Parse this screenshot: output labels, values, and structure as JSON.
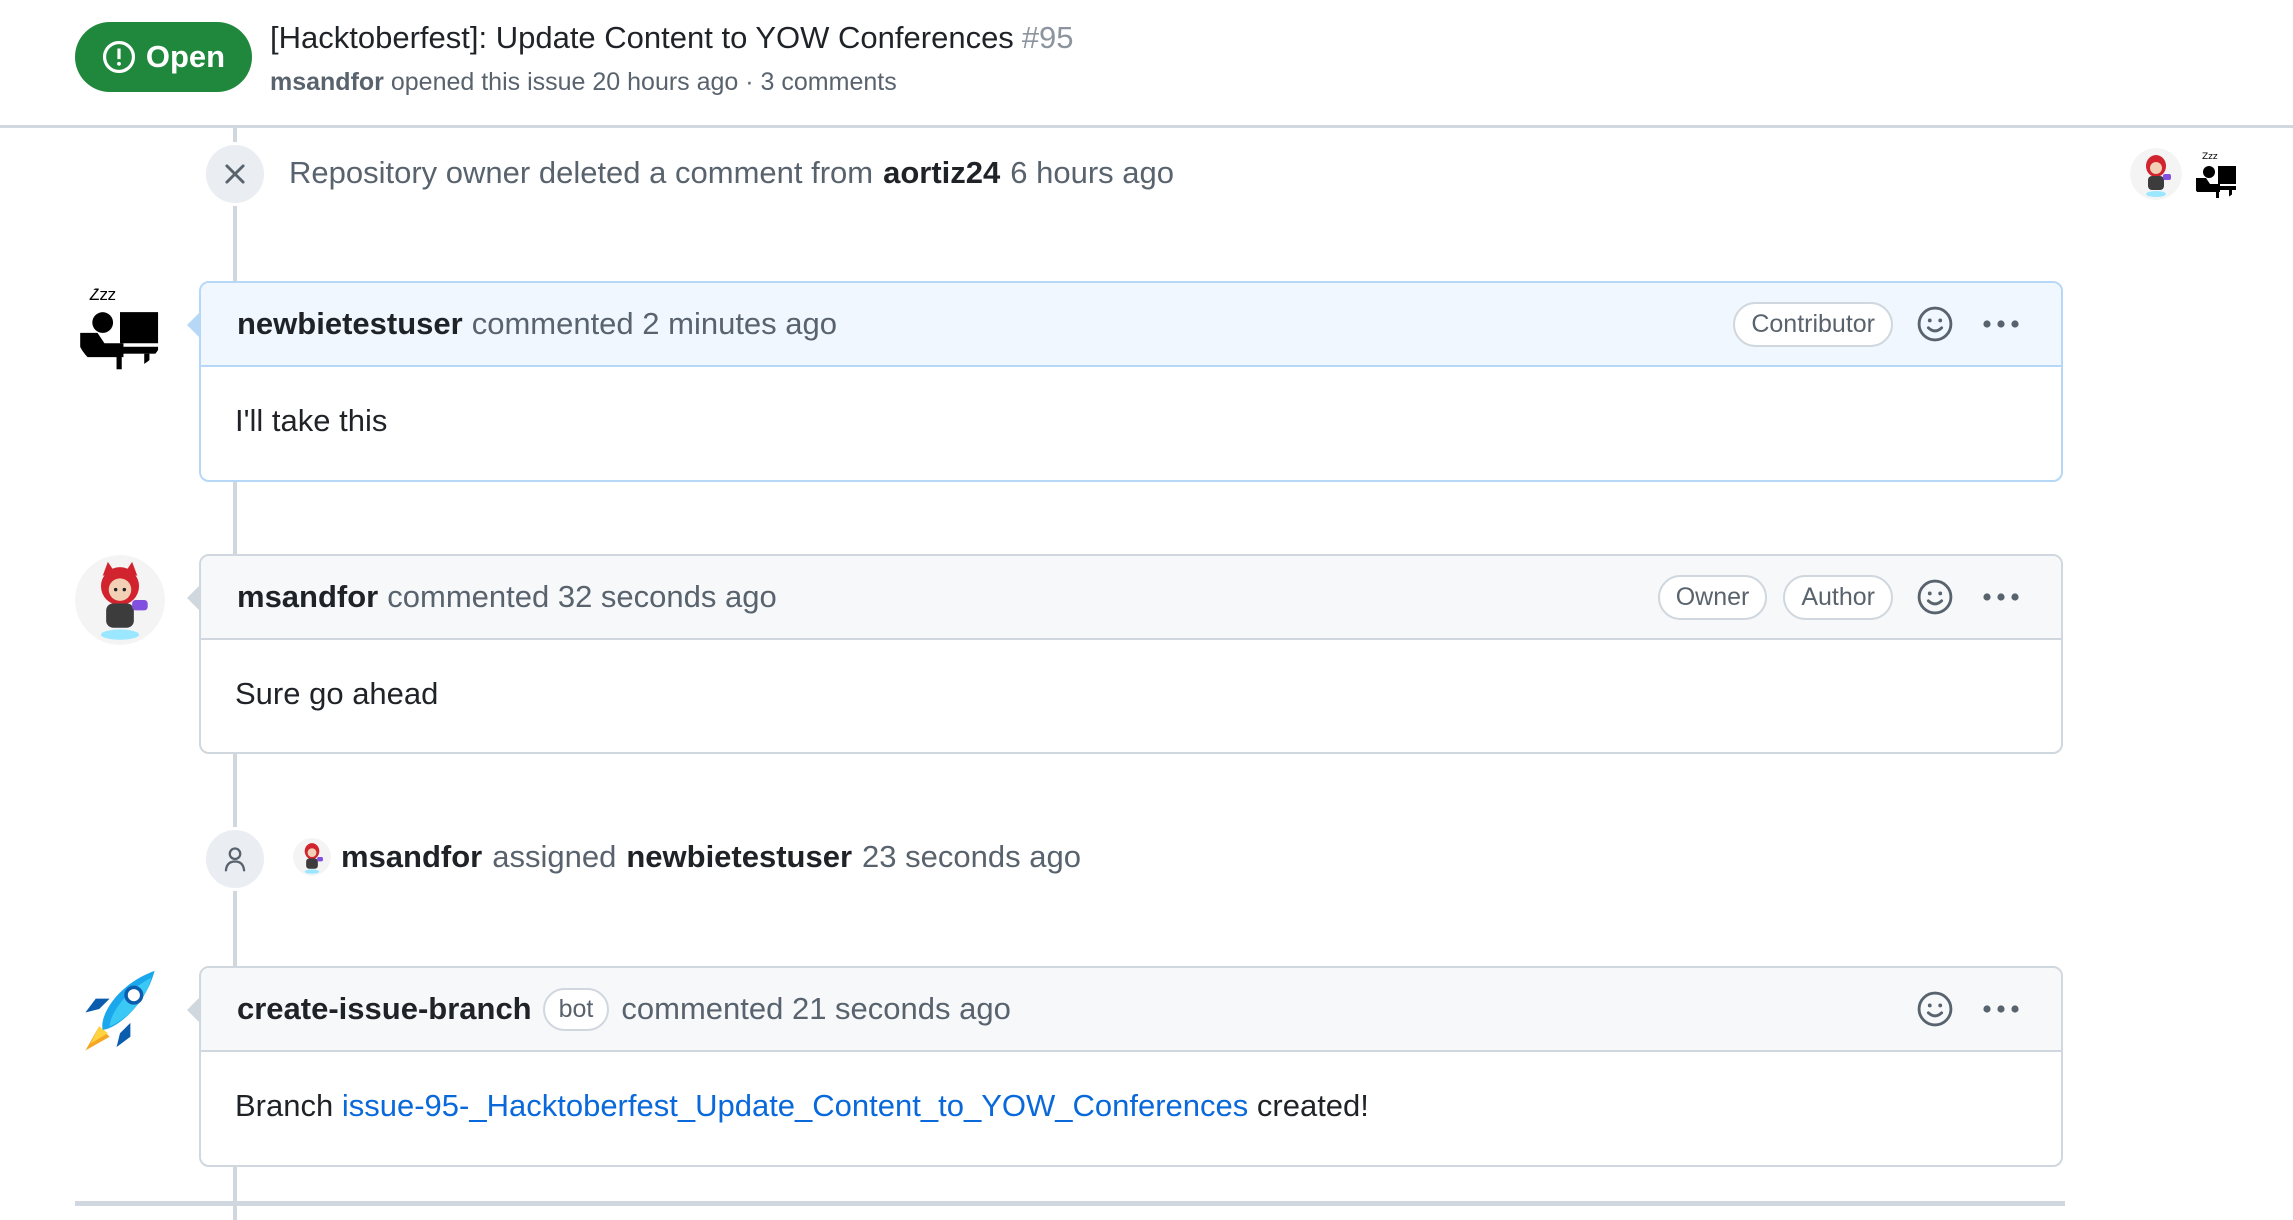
{
  "issue": {
    "state": "Open",
    "title": "[Hacktoberfest]: Update Content to YOW Conferences",
    "number": "#95",
    "opened_by": "msandfor",
    "meta": "opened this issue 20 hours ago · 3 comments"
  },
  "deleted_event": {
    "icon": "x-icon",
    "text": "Repository owner deleted a comment from",
    "actor": "aortiz24",
    "time": "6 hours ago"
  },
  "comments": [
    {
      "author": "newbietestuser",
      "action": "commented 2 minutes ago",
      "labels": [
        "Contributor"
      ],
      "body": "I'll take this"
    },
    {
      "author": "msandfor",
      "action": "commented 32 seconds ago",
      "labels": [
        "Owner",
        "Author"
      ],
      "body": "Sure go ahead"
    },
    {
      "author": "create-issue-branch",
      "bot_label": "bot",
      "action": "commented 21 seconds ago",
      "body_prefix": "Branch",
      "branch_link": "issue-95-_Hacktoberfest_Update_Content_to_YOW_Conferences",
      "body_suffix": "created!"
    }
  ],
  "assign_event": {
    "icon": "person-icon",
    "actor": "msandfor",
    "verb": "assigned",
    "assignee": "newbietestuser",
    "time": "23 seconds ago"
  },
  "colors": {
    "open_green": "#1f883d",
    "link_blue": "#0969da",
    "border": "#d0d7de",
    "muted": "#59636e"
  }
}
